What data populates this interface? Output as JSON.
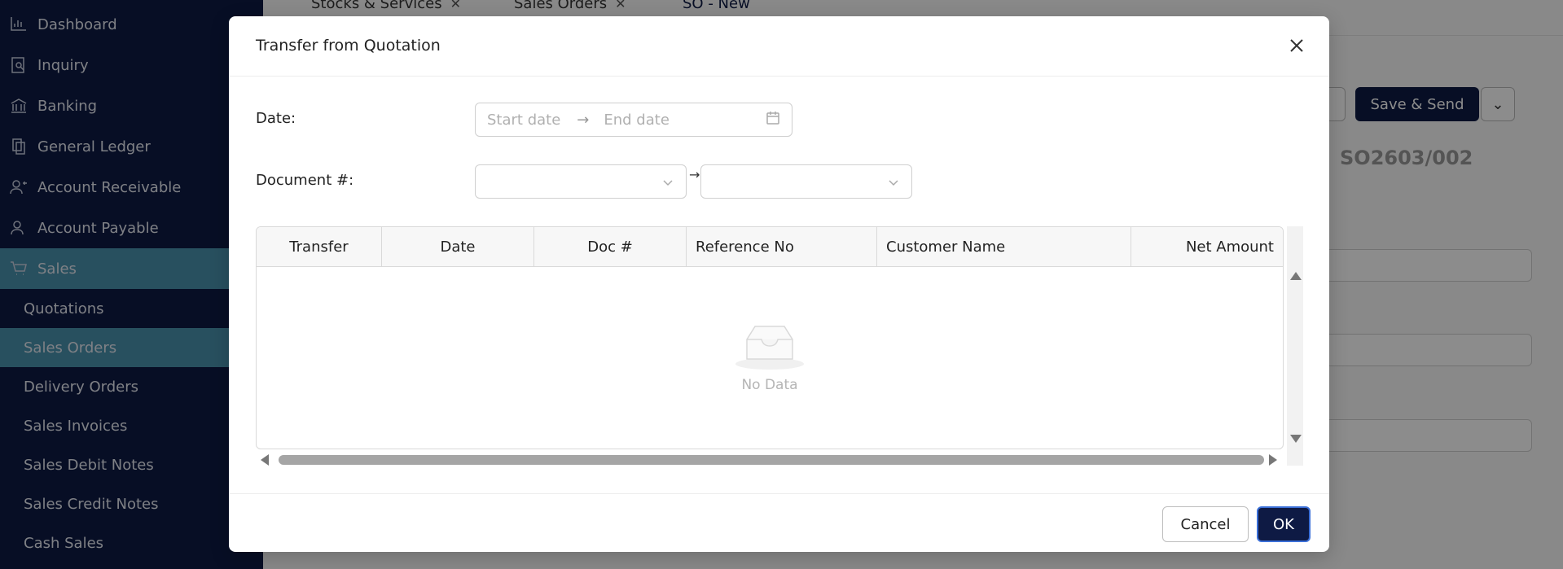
{
  "sidebar": {
    "items": [
      {
        "label": "Dashboard",
        "icon": "dashboard-icon"
      },
      {
        "label": "Inquiry",
        "icon": "inquiry-icon"
      },
      {
        "label": "Banking",
        "icon": "bank-icon"
      },
      {
        "label": "General Ledger",
        "icon": "ledger-icon"
      },
      {
        "label": "Account Receivable",
        "icon": "receivable-icon"
      },
      {
        "label": "Account Payable",
        "icon": "payable-icon"
      },
      {
        "label": "Sales",
        "icon": "cart-icon"
      }
    ],
    "sub_items": [
      {
        "label": "Quotations"
      },
      {
        "label": "Sales Orders"
      },
      {
        "label": "Delivery Orders"
      },
      {
        "label": "Sales Invoices"
      },
      {
        "label": "Sales Debit Notes"
      },
      {
        "label": "Sales Credit Notes"
      },
      {
        "label": "Cash Sales"
      }
    ],
    "active_color": "#4a93ad",
    "bg_color": "#0e1a44"
  },
  "tabs": [
    {
      "label": "Stocks & Services"
    },
    {
      "label": "Sales Orders"
    },
    {
      "label": "SO - New"
    }
  ],
  "background": {
    "save_send_label": "Save & Send",
    "doc_number": "SO2603/002"
  },
  "modal": {
    "title": "Transfer from Quotation",
    "date_label": "Date",
    "start_date_placeholder": "Start date",
    "end_date_placeholder": "End date",
    "doc_label": "Document #",
    "columns": [
      "Transfer",
      "Date",
      "Doc #",
      "Reference No",
      "Customer Name",
      "Net Amount"
    ],
    "empty_text": "No Data",
    "cancel_label": "Cancel",
    "ok_label": "OK"
  }
}
